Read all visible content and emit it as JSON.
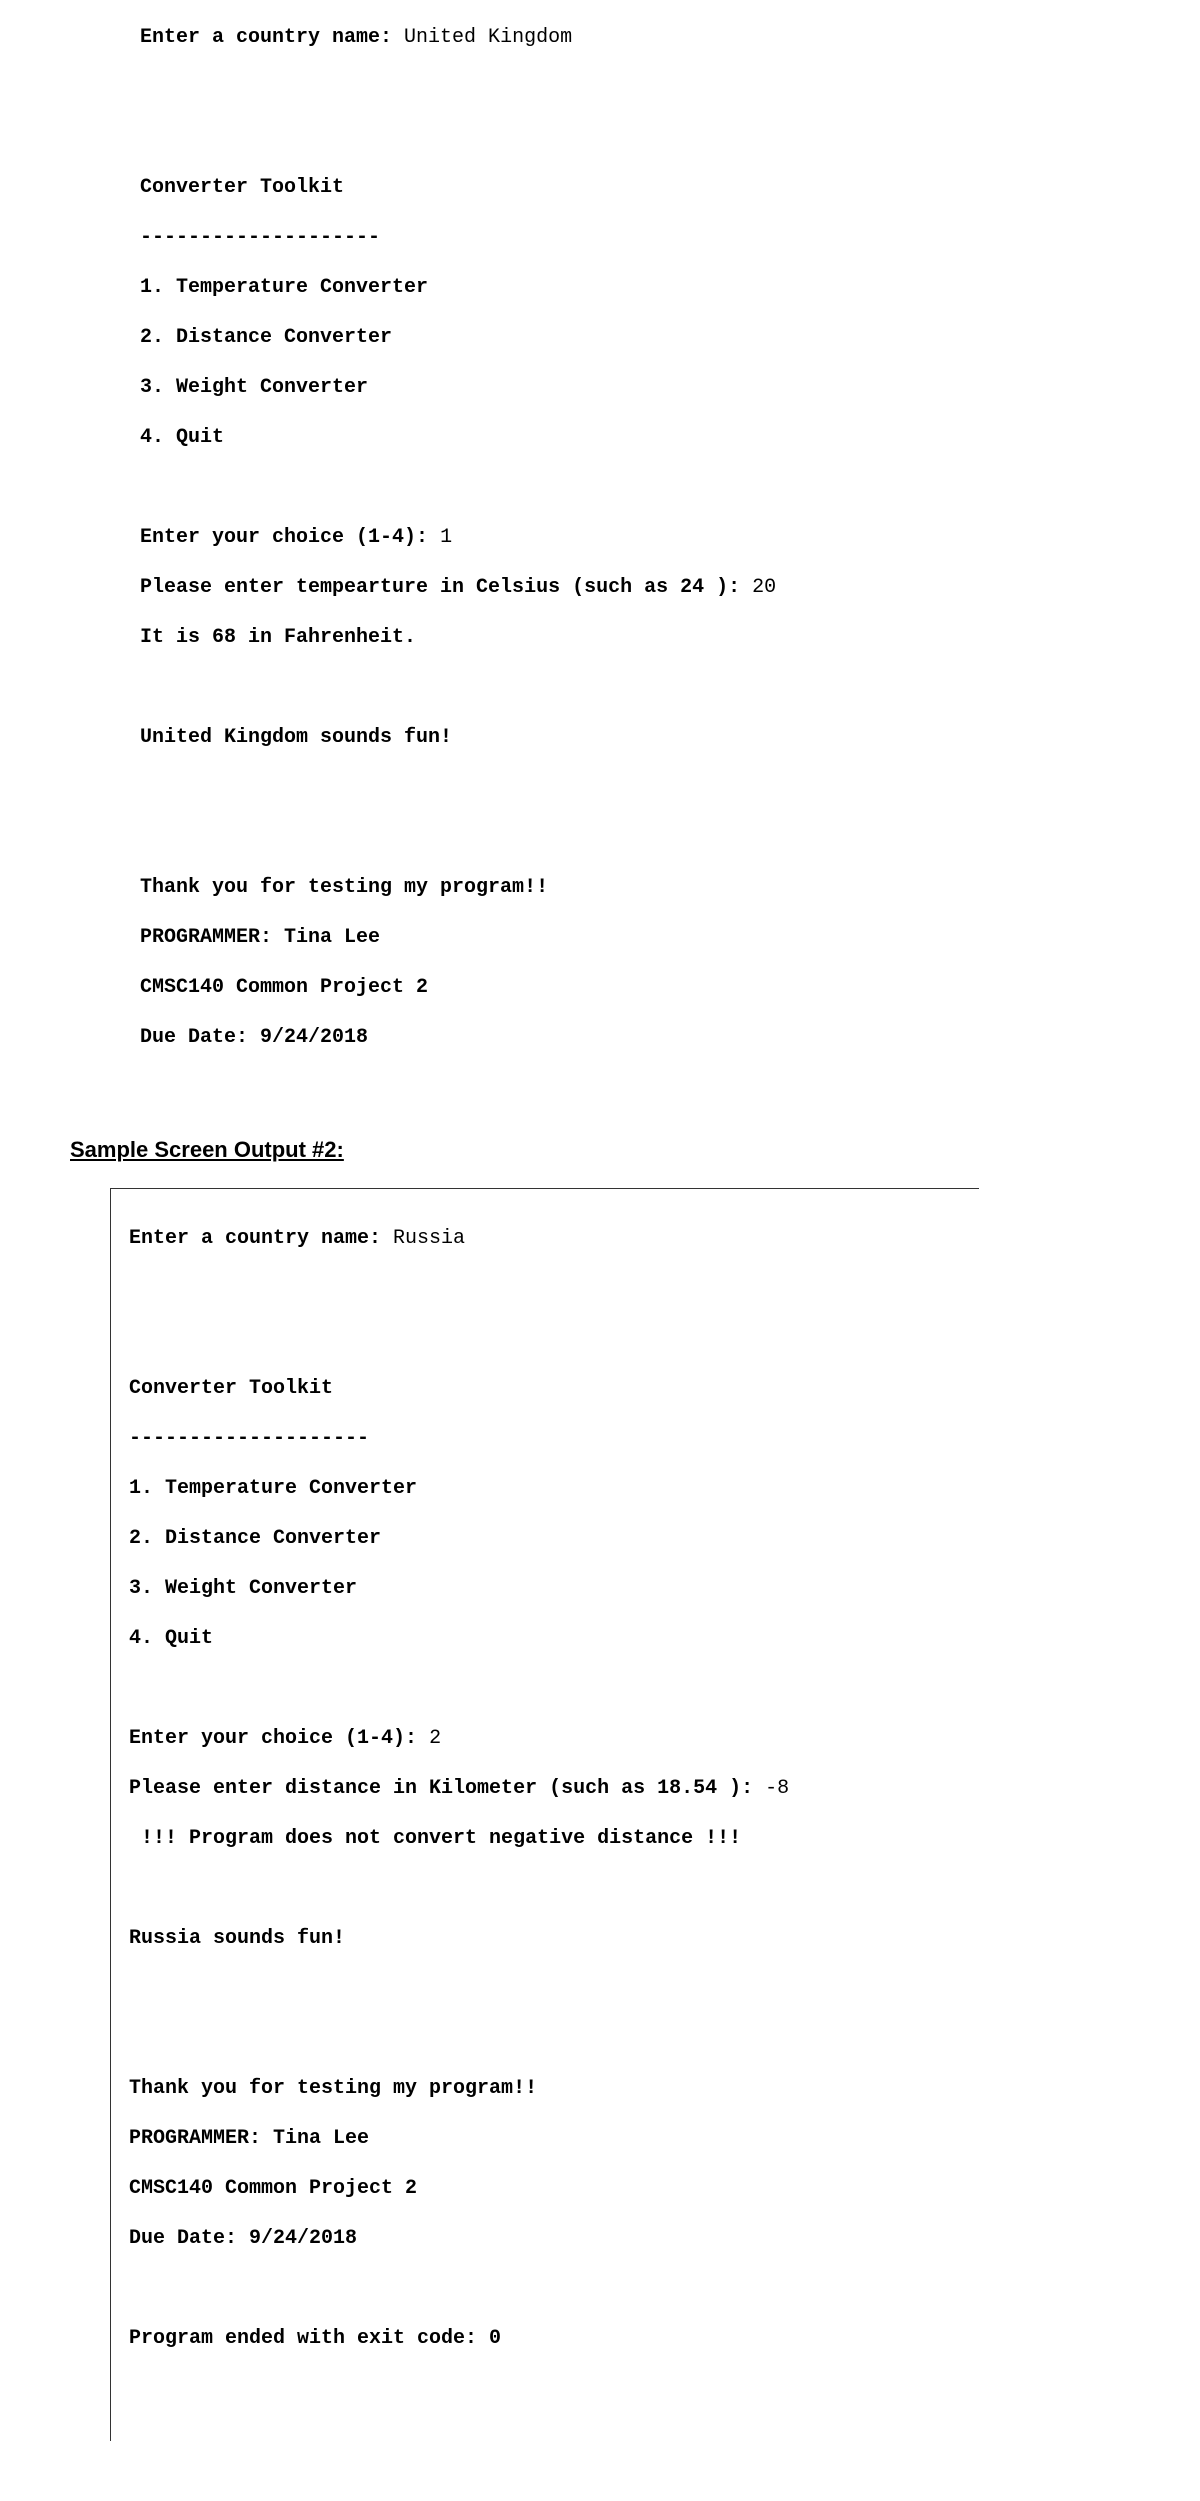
{
  "sample1": {
    "prompt_country_label": "Enter a country name: ",
    "country_value": "United Kingdom",
    "toolkit_title": "Converter Toolkit",
    "toolkit_underline": "--------------------",
    "menu": [
      "1. Temperature Converter",
      "2. Distance Converter",
      "3. Weight Converter",
      "4. Quit"
    ],
    "choice_prompt": "Enter your choice (1-4): ",
    "choice_value": "1",
    "temp_prompt": "Please enter tempearture in Celsius (such as 24 ): ",
    "temp_value": "20",
    "temp_result": "It is 68 in Fahrenheit.",
    "fun_line": "United Kingdom sounds fun!",
    "thanks": "Thank you for testing my program!!",
    "programmer": "PROGRAMMER: Tina Lee",
    "course": "CMSC140 Common Project 2",
    "due": "Due Date: 9/24/2018"
  },
  "heading2": "Sample Screen Output #2:",
  "sample2": {
    "prompt_country_label": "Enter a country name: ",
    "country_value": "Russia",
    "toolkit_title": "Converter Toolkit",
    "toolkit_underline": "--------------------",
    "menu": [
      "1. Temperature Converter",
      "2. Distance Converter",
      "3. Weight Converter",
      "4. Quit"
    ],
    "choice_prompt": "Enter your choice (1-4): ",
    "choice_value": "2",
    "dist_prompt": "Please enter distance in Kilometer (such as 18.54 ): ",
    "dist_value": "-8",
    "dist_error": " !!! Program does not convert negative distance !!!",
    "fun_line": "Russia sounds fun!",
    "thanks": "Thank you for testing my program!!",
    "programmer": "PROGRAMMER: Tina Lee",
    "course": "CMSC140 Common Project 2",
    "due": "Due Date: 9/24/2018",
    "exit_line": "Program ended with exit code: 0"
  }
}
